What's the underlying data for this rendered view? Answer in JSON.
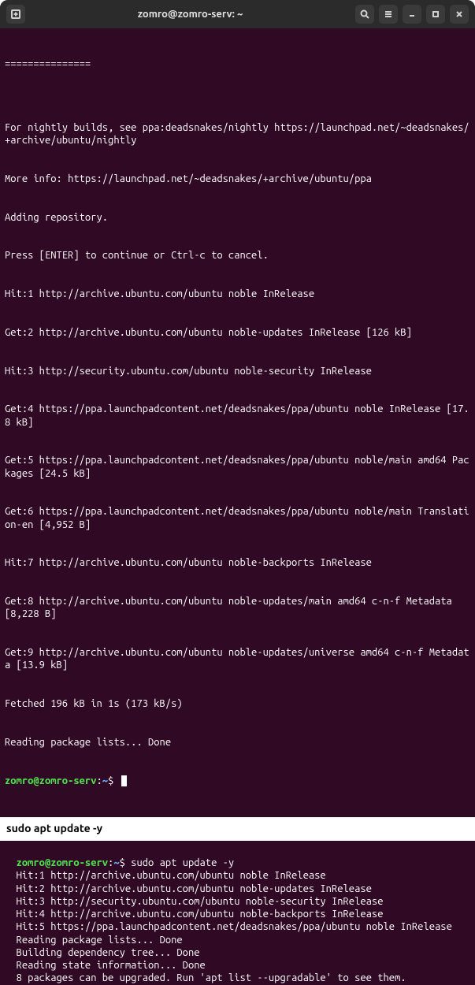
{
  "window": {
    "title": "zomro@zomro-serv: ~"
  },
  "terminal1": {
    "lines": [
      "===============",
      "",
      "For nightly builds, see ppa:deadsnakes/nightly https://launchpad.net/~deadsnakes/+archive/ubuntu/nightly",
      "More info: https://launchpad.net/~deadsnakes/+archive/ubuntu/ppa",
      "Adding repository.",
      "Press [ENTER] to continue or Ctrl-c to cancel.",
      "Hit:1 http://archive.ubuntu.com/ubuntu noble InRelease",
      "Get:2 http://archive.ubuntu.com/ubuntu noble-updates InRelease [126 kB]",
      "Hit:3 http://security.ubuntu.com/ubuntu noble-security InRelease",
      "Get:4 https://ppa.launchpadcontent.net/deadsnakes/ppa/ubuntu noble InRelease [17.8 kB]",
      "Get:5 https://ppa.launchpadcontent.net/deadsnakes/ppa/ubuntu noble/main amd64 Packages [24.5 kB]",
      "Get:6 https://ppa.launchpadcontent.net/deadsnakes/ppa/ubuntu noble/main Translation-en [4,952 B]",
      "Hit:7 http://archive.ubuntu.com/ubuntu noble-backports InRelease",
      "Get:8 http://archive.ubuntu.com/ubuntu noble-updates/main amd64 c-n-f Metadata [8,228 B]",
      "Get:9 http://archive.ubuntu.com/ubuntu noble-updates/universe amd64 c-n-f Metadata [13.9 kB]",
      "Fetched 196 kB in 1s (173 kB/s)",
      "Reading package lists... Done"
    ],
    "prompt": {
      "user_host": "zomro@zomro-serv",
      "path": "~",
      "symbol": "$"
    }
  },
  "divider": {
    "command_label": "sudo apt update -y"
  },
  "terminal2": {
    "prompt": {
      "user_host": "zomro@zomro-serv",
      "path": "~",
      "symbol": "$",
      "command": "sudo apt update -y"
    },
    "lines": [
      "Hit:1 http://archive.ubuntu.com/ubuntu noble InRelease",
      "Hit:2 http://archive.ubuntu.com/ubuntu noble-updates InRelease",
      "Hit:3 http://security.ubuntu.com/ubuntu noble-security InRelease",
      "Hit:4 http://archive.ubuntu.com/ubuntu noble-backports InRelease",
      "Hit:5 https://ppa.launchpadcontent.net/deadsnakes/ppa/ubuntu noble InRelease",
      "Reading package lists... Done",
      "Building dependency tree... Done",
      "Reading state information... Done",
      "8 packages can be upgraded. Run 'apt list --upgradable' to see them."
    ]
  }
}
